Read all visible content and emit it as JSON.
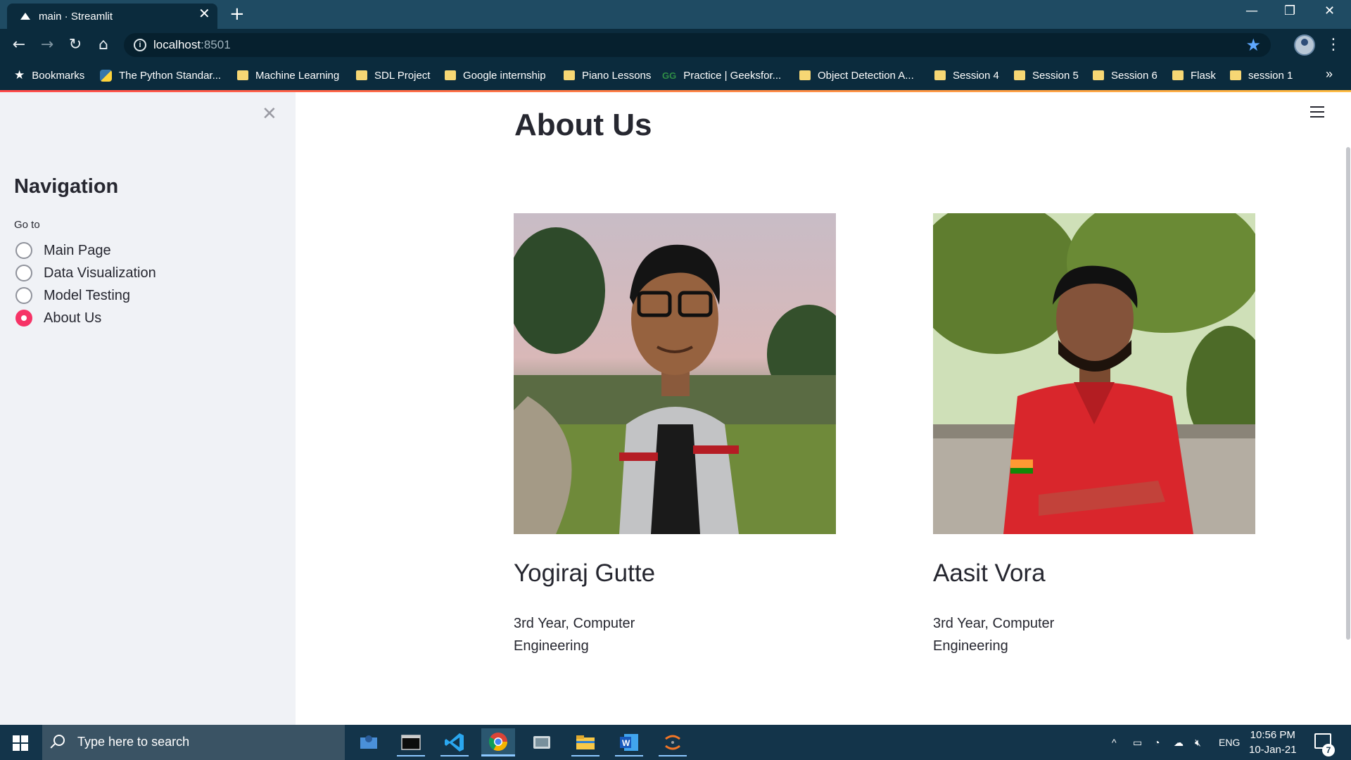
{
  "browser": {
    "tab_title": "main · Streamlit",
    "tab_close": "✕",
    "new_tab": "+",
    "window_controls": {
      "minimize": "—",
      "restore": "❐",
      "close": "✕"
    },
    "url_host": "localhost",
    "url_port": ":8501",
    "bookmarks": [
      {
        "label": "Bookmarks",
        "icon": "star-icon"
      },
      {
        "label": "The Python Standar...",
        "icon": "python-icon"
      },
      {
        "label": "Machine Learning",
        "icon": "folder-icon"
      },
      {
        "label": "SDL Project",
        "icon": "folder-icon"
      },
      {
        "label": "Google internship",
        "icon": "folder-icon"
      },
      {
        "label": "Piano Lessons",
        "icon": "folder-icon"
      },
      {
        "label": "Practice | Geeksfor...",
        "icon": "geeksforgeeks-icon"
      },
      {
        "label": "Object Detection A...",
        "icon": "folder-icon"
      },
      {
        "label": "Session 4",
        "icon": "folder-icon"
      },
      {
        "label": "Session 5",
        "icon": "folder-icon"
      },
      {
        "label": "Session 6",
        "icon": "folder-icon"
      },
      {
        "label": "Flask",
        "icon": "folder-icon"
      },
      {
        "label": "session 1",
        "icon": "folder-icon"
      }
    ],
    "bookmarks_more": "»"
  },
  "sidebar": {
    "title": "Navigation",
    "radio_label": "Go to",
    "options": [
      {
        "label": "Main Page",
        "selected": false
      },
      {
        "label": "Data Visualization",
        "selected": false
      },
      {
        "label": "Model Testing",
        "selected": false
      },
      {
        "label": "About Us",
        "selected": true
      }
    ]
  },
  "main": {
    "title": "About Us",
    "members": [
      {
        "name": "Yogiraj Gutte",
        "desc_line1": "3rd Year, Computer",
        "desc_line2": "Engineering"
      },
      {
        "name": "Aasit Vora",
        "desc_line1": "3rd Year, Computer",
        "desc_line2": "Engineering"
      }
    ]
  },
  "taskbar": {
    "search_placeholder": "Type here to search",
    "language": "ENG",
    "time": "10:56 PM",
    "date": "10-Jan-21",
    "notification_count": "7"
  },
  "colors": {
    "accent": "#f63366",
    "browser_frame": "#1f4b63",
    "sidebar_bg": "#f0f2f6",
    "text": "#262730"
  }
}
